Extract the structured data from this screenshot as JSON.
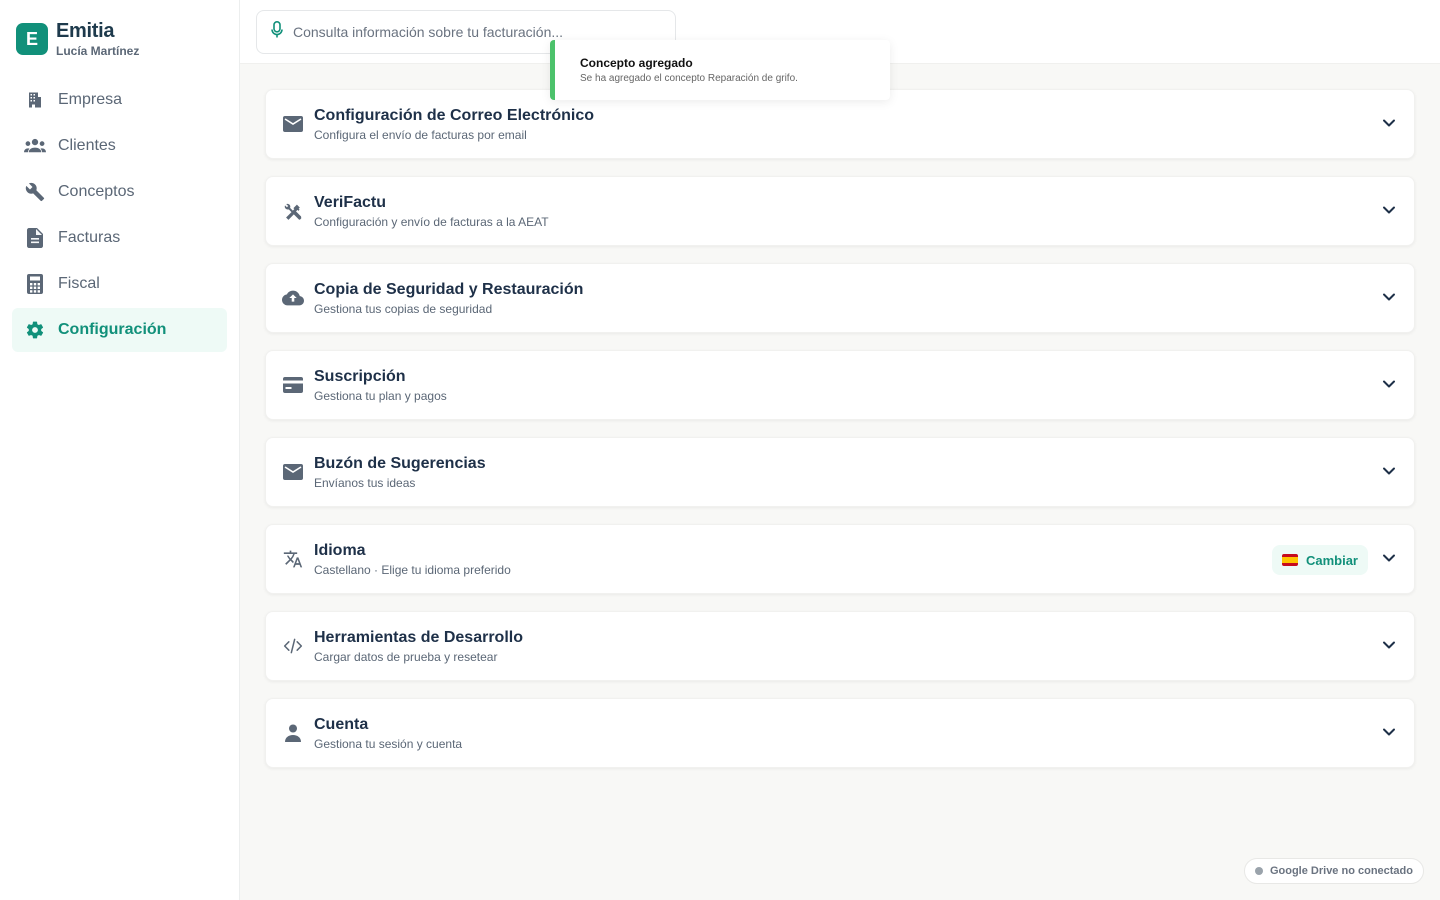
{
  "brand": {
    "logo_letter": "E",
    "name": "Emitia",
    "user": "Lucía Martínez"
  },
  "nav": [
    {
      "label": "Empresa",
      "icon": "building-icon"
    },
    {
      "label": "Clientes",
      "icon": "users-icon"
    },
    {
      "label": "Conceptos",
      "icon": "wrench-icon"
    },
    {
      "label": "Facturas",
      "icon": "document-icon"
    },
    {
      "label": "Fiscal",
      "icon": "calculator-icon"
    },
    {
      "label": "Configuración",
      "icon": "gear-icon",
      "active": true
    }
  ],
  "search": {
    "placeholder": "Consulta información sobre tu facturación..."
  },
  "toast": {
    "title": "Concepto agregado",
    "message": "Se ha agregado el concepto Reparación de grifo."
  },
  "sections": [
    {
      "title": "Configuración de Correo Electrónico",
      "subtitle": "Configura el envío de facturas por email",
      "icon": "mail-icon"
    },
    {
      "title": "VeriFactu",
      "subtitle": "Configuración y envío de facturas a la AEAT",
      "icon": "tools-icon"
    },
    {
      "title": "Copia de Seguridad y Restauración",
      "subtitle": "Gestiona tus copias de seguridad",
      "icon": "cloud-upload-icon"
    },
    {
      "title": "Suscripción",
      "subtitle": "Gestiona tu plan y pagos",
      "icon": "credit-card-icon"
    },
    {
      "title": "Buzón de Sugerencias",
      "subtitle": "Envíanos tus ideas",
      "icon": "mail-icon"
    },
    {
      "title": "Idioma",
      "subtitle": "Castellano · Elige tu idioma preferido",
      "icon": "translate-icon"
    },
    {
      "title": "Herramientas de Desarrollo",
      "subtitle": "Cargar datos de prueba y resetear",
      "icon": "code-icon"
    },
    {
      "title": "Cuenta",
      "subtitle": "Gestiona tu sesión y cuenta",
      "icon": "person-icon"
    }
  ],
  "language_badge": {
    "label": "Cambiar",
    "flag": "spain-flag-icon"
  },
  "drive_status": {
    "label": "Google Drive no conectado"
  },
  "colors": {
    "accent": "#11907a",
    "toast_bar": "#4cc26b",
    "text_dark": "#1e3048",
    "text_muted": "#5b6776"
  }
}
